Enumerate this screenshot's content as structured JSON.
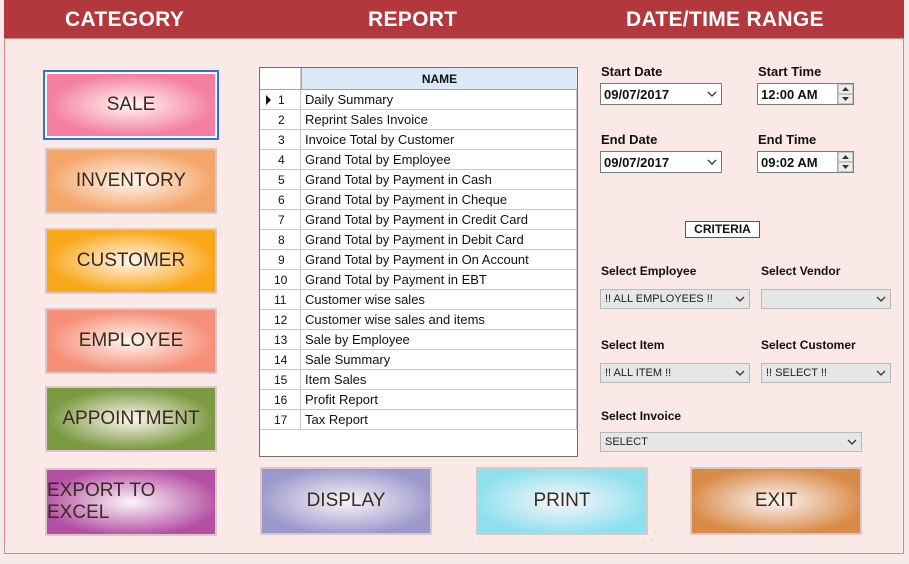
{
  "header": {
    "category": "CATEGORY",
    "report": "REPORT",
    "range": "DATE/TIME RANGE"
  },
  "categories": [
    {
      "label": "SALE",
      "color": "#f47fa0"
    },
    {
      "label": "INVENTORY",
      "color": "#f4a66a"
    },
    {
      "label": "CUSTOMER",
      "color": "#f9a81a"
    },
    {
      "label": "EMPLOYEE",
      "color": "#f58f78"
    },
    {
      "label": "APPOINTMENT",
      "color": "#7c9a42"
    }
  ],
  "bottom_buttons": [
    {
      "label": "EXPORT TO EXCEL",
      "color": "#b44fa3"
    },
    {
      "label": "DISPLAY",
      "color": "#9c98cc"
    },
    {
      "label": "PRINT",
      "color": "#8ee0ef"
    },
    {
      "label": "EXIT",
      "color": "#d98a46"
    }
  ],
  "grid": {
    "column": "NAME",
    "rows": [
      {
        "num": "1",
        "name": "Daily Summary"
      },
      {
        "num": "2",
        "name": "Reprint Sales Invoice"
      },
      {
        "num": "3",
        "name": "Invoice Total by Customer"
      },
      {
        "num": "4",
        "name": "Grand Total by Employee"
      },
      {
        "num": "5",
        "name": "Grand Total by Payment in Cash"
      },
      {
        "num": "6",
        "name": "Grand Total by Payment in Cheque"
      },
      {
        "num": "7",
        "name": "Grand Total by Payment in Credit Card"
      },
      {
        "num": "8",
        "name": "Grand Total by Payment in Debit Card"
      },
      {
        "num": "9",
        "name": "Grand Total by Payment in On Account"
      },
      {
        "num": "10",
        "name": "Grand Total by Payment in EBT"
      },
      {
        "num": "11",
        "name": "Customer wise sales"
      },
      {
        "num": "12",
        "name": "Customer wise sales and items"
      },
      {
        "num": "13",
        "name": "Sale by Employee"
      },
      {
        "num": "14",
        "name": "Sale Summary"
      },
      {
        "num": "15",
        "name": "Item Sales"
      },
      {
        "num": "16",
        "name": "Profit Report"
      },
      {
        "num": "17",
        "name": "Tax Report"
      }
    ]
  },
  "range": {
    "start_date_label": "Start Date",
    "start_date": "09/07/2017",
    "start_time_label": "Start Time",
    "start_time": "12:00 AM",
    "end_date_label": "End Date",
    "end_date": "09/07/2017",
    "end_time_label": "End Time",
    "end_time": "09:02 AM"
  },
  "criteria": {
    "title": "CRITERIA",
    "employee_label": "Select Employee",
    "employee_value": "!! ALL EMPLOYEES !!",
    "vendor_label": "Select Vendor",
    "vendor_value": "",
    "item_label": "Select Item",
    "item_value": "!! ALL ITEM !!",
    "customer_label": "Select Customer",
    "customer_value": "!! SELECT !!",
    "invoice_label": "Select Invoice",
    "invoice_value": "SELECT"
  }
}
